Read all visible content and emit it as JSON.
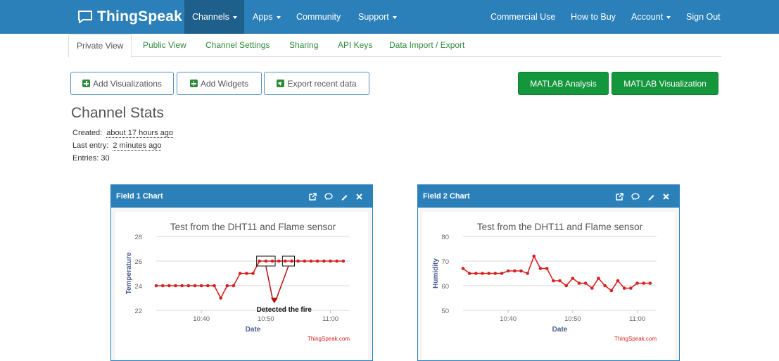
{
  "nav": {
    "brand": "ThingSpeak",
    "brand_tm": "™",
    "channels": "Channels",
    "apps": "Apps",
    "community": "Community",
    "support": "Support",
    "commercial": "Commercial Use",
    "how_to_buy": "How to Buy",
    "account": "Account",
    "sign_out": "Sign Out"
  },
  "tabs": [
    "Private View",
    "Public View",
    "Channel Settings",
    "Sharing",
    "API Keys",
    "Data Import / Export"
  ],
  "buttons": {
    "add_visualizations": "Add Visualizations",
    "add_widgets": "Add Widgets",
    "export_recent": "Export recent data",
    "matlab_analysis": "MATLAB Analysis",
    "matlab_visualization": "MATLAB Visualization"
  },
  "stats": {
    "title": "Channel Stats",
    "created_label": "Created:",
    "created_value": "about 17 hours ago",
    "last_entry_label": "Last entry:",
    "last_entry_value": "2 minutes ago",
    "entries_label": "Entries:",
    "entries_value": "30"
  },
  "charts": [
    {
      "panel_title": "Field 1 Chart",
      "annotation": "Detected the fire"
    },
    {
      "panel_title": "Field 2 Chart"
    }
  ],
  "chart_data": [
    {
      "type": "line",
      "title": "Test from the DHT11 and Flame sensor",
      "xlabel": "Date",
      "ylabel": "Temperature",
      "credit": "ThingSpeak.com",
      "color": "#d62020",
      "xlim": [
        "10:33",
        "11:03"
      ],
      "ylim": [
        22,
        28
      ],
      "yticks": [
        22,
        24,
        26,
        28
      ],
      "xticks": [
        "10:40",
        "10:50",
        "11:00"
      ],
      "x": [
        "10:33",
        "10:34",
        "10:35",
        "10:36",
        "10:37",
        "10:38",
        "10:39",
        "10:40",
        "10:41",
        "10:42",
        "10:43",
        "10:44",
        "10:45",
        "10:46",
        "10:47",
        "10:48",
        "10:49",
        "10:50",
        "10:51",
        "10:52",
        "10:53",
        "10:54",
        "10:55",
        "10:56",
        "10:57",
        "10:58",
        "10:59",
        "11:00",
        "11:01",
        "11:02"
      ],
      "y": [
        24,
        24,
        24,
        24,
        24,
        24,
        24,
        24,
        24,
        24,
        23,
        24,
        24,
        25,
        25,
        25,
        26,
        26,
        26,
        26,
        26,
        26,
        26,
        26,
        26,
        26,
        26,
        26,
        26,
        26
      ],
      "grid": true
    },
    {
      "type": "line",
      "title": "Test from the DHT11 and Flame sensor",
      "xlabel": "Date",
      "ylabel": "Humidity",
      "credit": "ThingSpeak.com",
      "color": "#d62020",
      "xlim": [
        "10:33",
        "11:03"
      ],
      "ylim": [
        50,
        80
      ],
      "yticks": [
        50,
        60,
        70,
        80
      ],
      "xticks": [
        "10:40",
        "10:50",
        "11:00"
      ],
      "x": [
        "10:33",
        "10:34",
        "10:35",
        "10:36",
        "10:37",
        "10:38",
        "10:39",
        "10:40",
        "10:41",
        "10:42",
        "10:43",
        "10:44",
        "10:45",
        "10:46",
        "10:47",
        "10:48",
        "10:49",
        "10:50",
        "10:51",
        "10:52",
        "10:53",
        "10:54",
        "10:55",
        "10:56",
        "10:57",
        "10:58",
        "10:59",
        "11:00",
        "11:01",
        "11:02"
      ],
      "y": [
        67,
        65,
        65,
        65,
        65,
        65,
        65,
        66,
        66,
        66,
        65,
        72,
        67,
        67,
        62,
        62,
        60,
        63,
        61,
        61,
        59,
        63,
        60,
        58,
        62,
        59,
        59,
        61,
        61,
        61
      ],
      "grid": true
    }
  ]
}
